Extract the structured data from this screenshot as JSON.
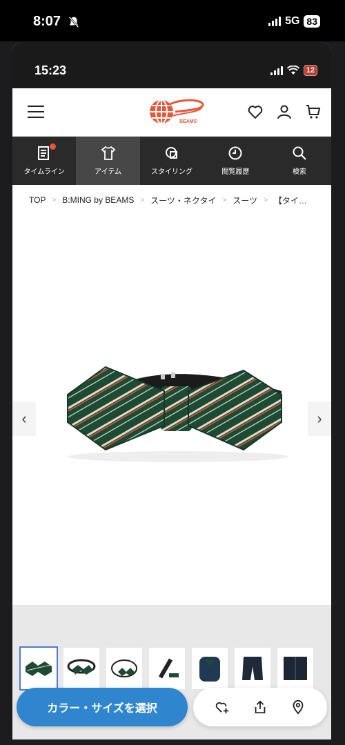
{
  "outer_status": {
    "time": "8:07",
    "network": "5G",
    "battery": "83"
  },
  "inner_status": {
    "time": "15:23",
    "battery": "12"
  },
  "header": {
    "logo_text": "BEAMS"
  },
  "nav": [
    {
      "label": "タイムライン",
      "icon": "timeline-icon"
    },
    {
      "label": "アイテム",
      "icon": "tshirt-icon"
    },
    {
      "label": "スタイリング",
      "icon": "styling-icon"
    },
    {
      "label": "閲覧履歴",
      "icon": "clock-icon"
    },
    {
      "label": "検索",
      "icon": "search-icon"
    }
  ],
  "breadcrumb": [
    "TOP",
    "B:MING by BEAMS",
    "スーツ・ネクタイ",
    "スーツ",
    "【タイ…"
  ],
  "cta": {
    "label": "カラー・サイズを選択"
  },
  "colors": {
    "accent": "#2f86cf",
    "brand": "#e8573a",
    "nav_bg": "#2a2a2a"
  }
}
